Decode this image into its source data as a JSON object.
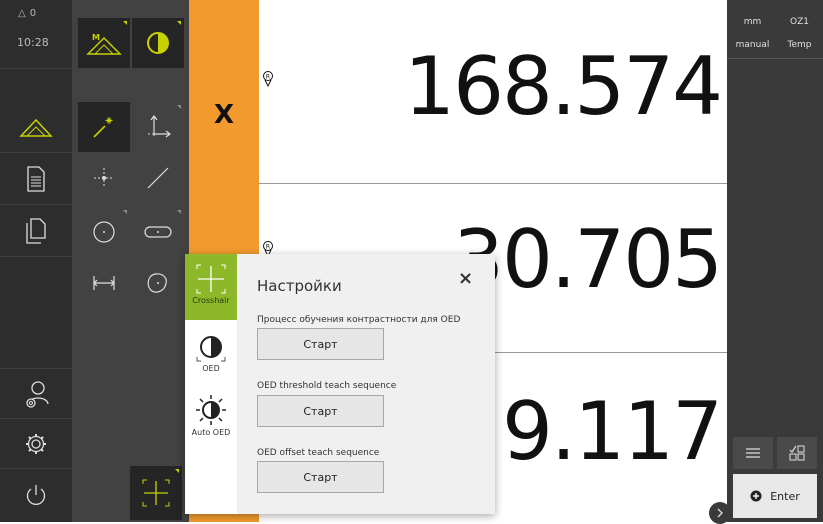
{
  "status": {
    "warning_count": "0",
    "time": "10:28"
  },
  "axis": {
    "label": "X"
  },
  "readouts": [
    {
      "value": "168.574"
    },
    {
      "value": "30.705"
    },
    {
      "value": "9.117"
    }
  ],
  "right_panel": {
    "unit_length": "mm",
    "reference": "OZ1",
    "mode": "manual",
    "temp_label": "Temp",
    "enter_label": "Enter"
  },
  "popup": {
    "title": "Настройки",
    "close_symbol": "×",
    "sections": [
      {
        "label": "Процесс обучения контрастности для OED",
        "button": "Старт"
      },
      {
        "label": "OED threshold teach sequence",
        "button": "Старт"
      },
      {
        "label": "OED offset teach sequence",
        "button": "Старт"
      }
    ],
    "modes": [
      {
        "label": "Crosshair",
        "icon": "crosshair-icon",
        "active": true
      },
      {
        "label": "OED",
        "icon": "contrast-icon",
        "active": false
      },
      {
        "label": "Auto OED",
        "icon": "auto-oed-icon",
        "active": false
      }
    ]
  },
  "colors": {
    "accent_orange": "#f39a2e",
    "accent_green": "#8cb82a",
    "sidebar": "#2d2d2d"
  }
}
